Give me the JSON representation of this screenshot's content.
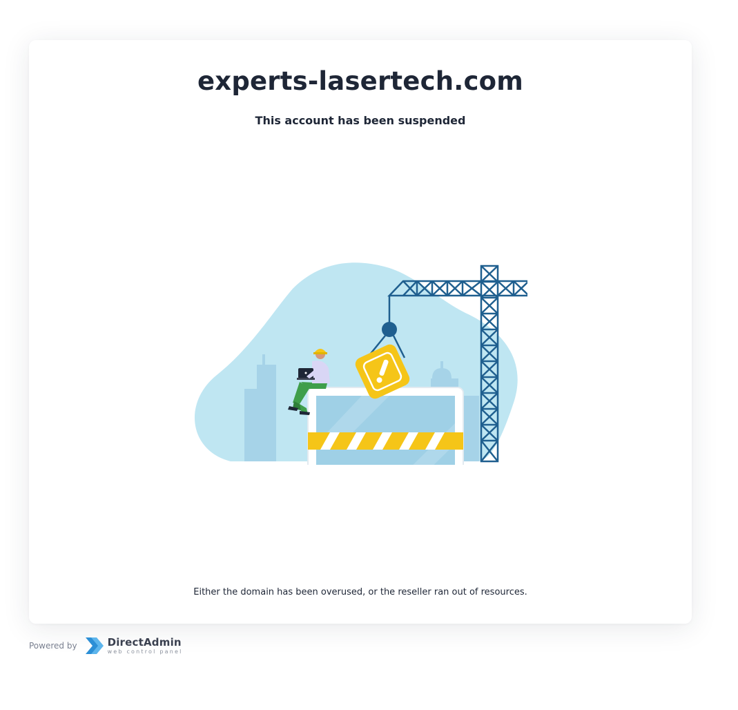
{
  "page": {
    "domain": "experts-lasertech.com",
    "status_message": "This account has been suspended",
    "reason": "Either the domain has been overused, or the reseller ran out of resources."
  },
  "footer": {
    "powered_by": "Powered by",
    "brand_name": "DirectAdmin",
    "brand_tagline": "web control panel",
    "brand_icon": "directadmin-chevron-icon"
  },
  "illustration": {
    "icon": "under-construction-illustration",
    "colors": {
      "blob": "#bfe6f2",
      "buildings": "#a6d3e8",
      "crane": "#1f5f8f",
      "warning": "#f5c518",
      "screen": "#9fd0e6",
      "stripe_yellow": "#f5c518",
      "laptop": "#ffffff"
    }
  }
}
